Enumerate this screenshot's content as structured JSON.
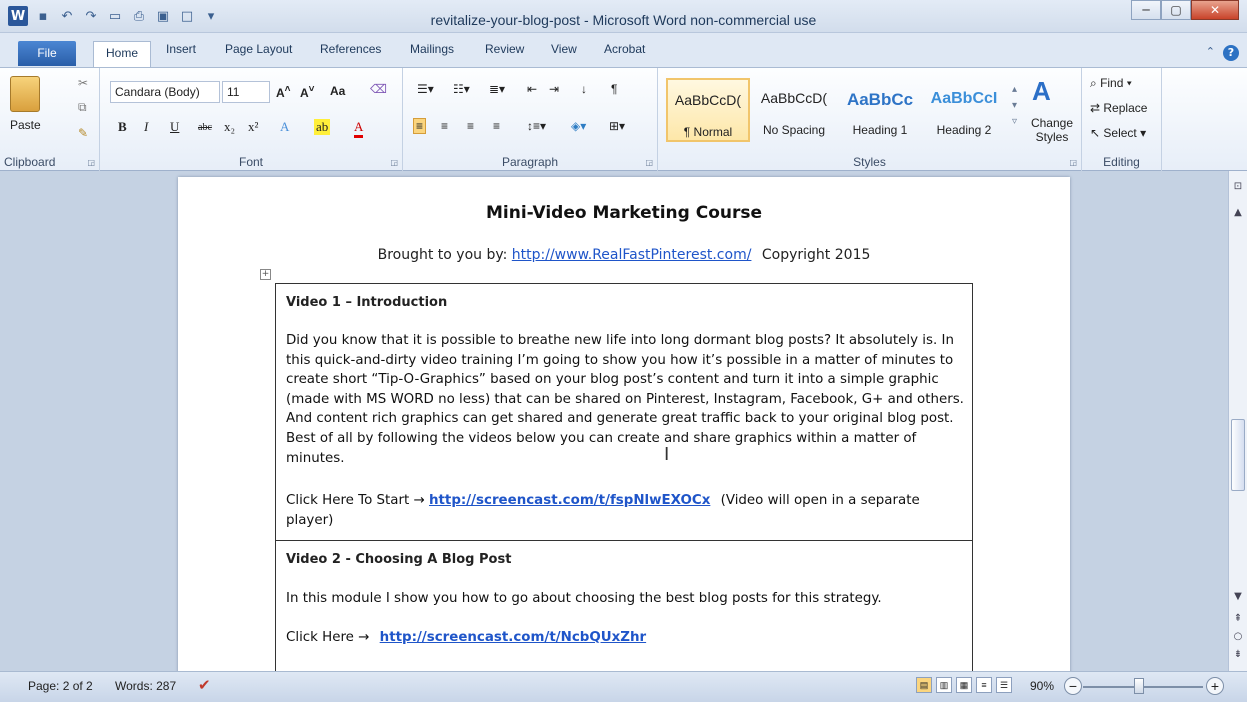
{
  "window": {
    "title": "revitalize-your-blog-post - Microsoft Word non-commercial use",
    "app_icon": "W"
  },
  "qat": {
    "icons": [
      "save-icon",
      "undo-icon",
      "redo-icon",
      "open-icon",
      "print-icon",
      "print-preview-icon",
      "new-icon",
      "customize-icon"
    ]
  },
  "tabs": [
    "File",
    "Home",
    "Insert",
    "Page Layout",
    "References",
    "Mailings",
    "Review",
    "View",
    "Acrobat"
  ],
  "ribbon": {
    "clipboard": {
      "label": "Clipboard",
      "paste": "Paste"
    },
    "font": {
      "label": "Font",
      "family": "Candara (Body)",
      "size": "11",
      "case_btn": "Aa"
    },
    "paragraph": {
      "label": "Paragraph"
    },
    "styles": {
      "label": "Styles",
      "items": [
        {
          "sample": "AaBbCcD(",
          "name": "¶ Normal"
        },
        {
          "sample": "AaBbCcD(",
          "name": "No Spacing"
        },
        {
          "sample": "AaBbCc",
          "name": "Heading 1"
        },
        {
          "sample": "AaBbCcI",
          "name": "Heading 2"
        }
      ],
      "change": "Change Styles"
    },
    "editing": {
      "label": "Editing",
      "find": "Find",
      "replace": "Replace",
      "select": "Select"
    }
  },
  "document": {
    "title": "Mini-Video Marketing Course",
    "byline_prefix": "Brought to you by:",
    "byline_link": "http://www.RealFastPinterest.com/",
    "byline_suffix": "Copyright 2015",
    "video1": {
      "heading": "Video 1 – Introduction",
      "body": "Did you know that it is possible to breathe new life into long dormant blog posts?  It absolutely is.  In this quick-and-dirty video training I’m going to show you how it’s possible in a matter of minutes to create short “Tip-O-Graphics” based on your blog post’s content and turn it into a simple graphic (made with MS WORD no less)  that can be shared on Pinterest, Instagram, Facebook, G+ and others.  And content rich graphics can get shared and generate great traffic back to your original blog post.  Best of all by following the videos below you can create and share graphics within a matter of minutes.",
      "cta": "Click Here  To Start →",
      "link": "http://screencast.com/t/fspNlwEXOCx",
      "note": "(Video will open in a separate player)"
    },
    "video2": {
      "heading": "Video 2 - Choosing A Blog Post",
      "body": "In this module I show you how to go about choosing the best blog posts for this strategy.",
      "cta": "Click Here →",
      "link": "http://screencast.com/t/NcbQUxZhr"
    }
  },
  "status": {
    "page": "Page: 2 of 2",
    "words": "Words: 287",
    "zoom": "90%"
  }
}
